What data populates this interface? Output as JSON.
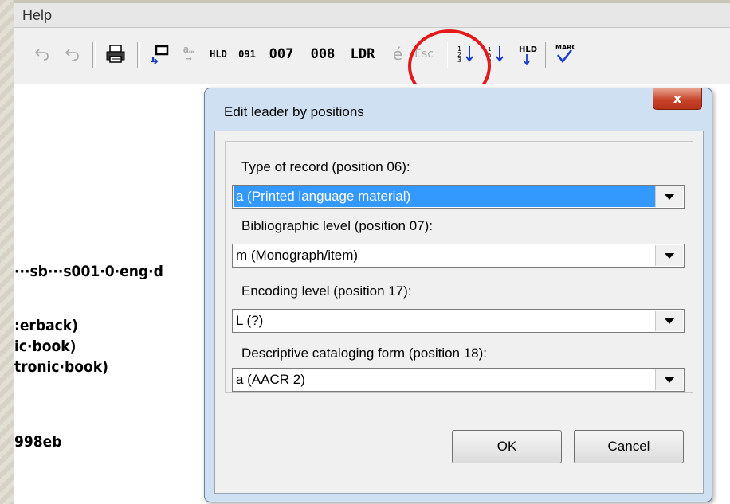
{
  "menubar": {
    "help_label": "Help"
  },
  "toolbar": {
    "undo_icon": "undo-icon",
    "redo_icon": "redo-icon",
    "print_icon": "printer-icon",
    "field_001_label": "007",
    "field_008_label": "008",
    "ldr_label": "LDR",
    "esc_label": "Esc",
    "hld_label": "HLD",
    "f091_label": "091",
    "marc_label": "MARC"
  },
  "record_lines": [
    "···sb···s001·0·eng·d",
    ":erback)",
    "ic·book)",
    "tronic·book)",
    "998eb"
  ],
  "dialog": {
    "title": "Edit leader by positions",
    "close_label": "x",
    "fields": [
      {
        "label": "Type of record (position 06):",
        "value": "a (Printed language material)"
      },
      {
        "label": "Bibliographic level (position 07):",
        "value": "m (Monograph/item)"
      },
      {
        "label": "Encoding level (position 17):",
        "value": "L (?)"
      },
      {
        "label": "Descriptive cataloging form (position 18):",
        "value": "a (AACR 2)"
      }
    ],
    "ok_label": "OK",
    "cancel_label": "Cancel"
  },
  "colors": {
    "highlight": "#3399ff",
    "annotation_circle": "#e51919",
    "dialog_frame": "#cfe0f3"
  }
}
